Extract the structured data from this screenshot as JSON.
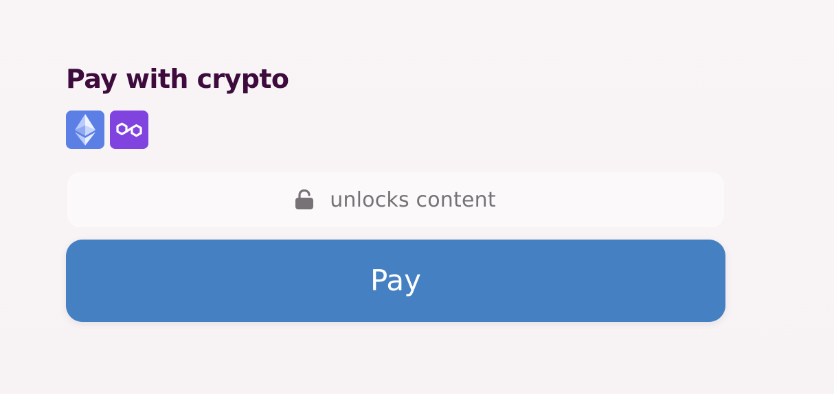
{
  "payment": {
    "title": "Pay with crypto",
    "chains": [
      {
        "name": "ethereum-icon",
        "color": "#5b7fe4"
      },
      {
        "name": "polygon-icon",
        "color": "#8043e0"
      }
    ],
    "unlock": {
      "icon": "unlock-icon",
      "text": "unlocks content"
    },
    "button": {
      "label": "Pay",
      "color": "#4580c2"
    },
    "colors": {
      "title": "#3e0b3d",
      "background": "#f8f4f6"
    }
  }
}
